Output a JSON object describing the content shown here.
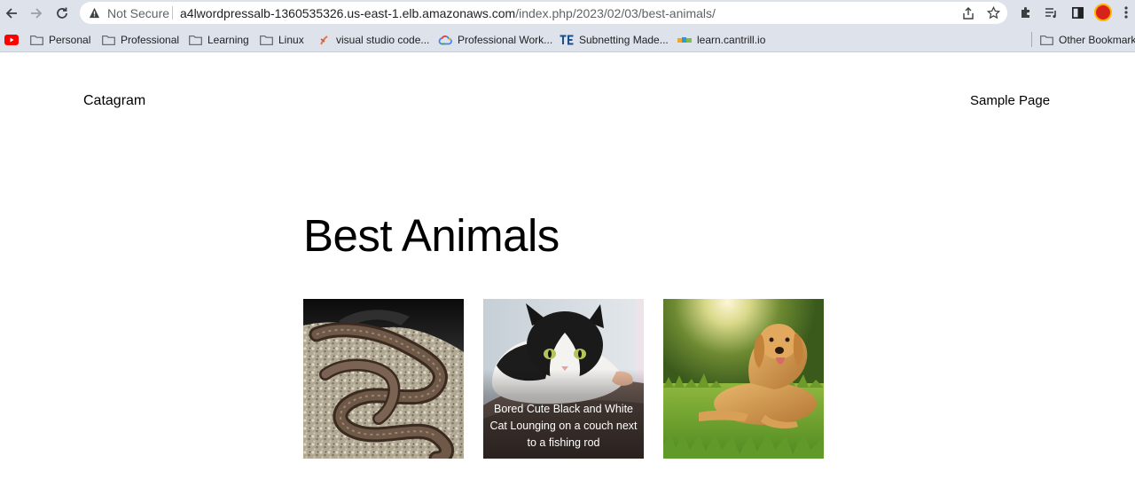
{
  "browser": {
    "security_label": "Not Secure",
    "url_host": "a4lwordpressalb-1360535326.us-east-1.elb.amazonaws.com",
    "url_path": "/index.php/2023/02/03/best-animals/"
  },
  "bookmarks": {
    "items": [
      {
        "label": "Personal",
        "icon": "folder-icon"
      },
      {
        "label": "Professional",
        "icon": "folder-icon"
      },
      {
        "label": "Learning",
        "icon": "folder-icon"
      },
      {
        "label": "Linux",
        "icon": "folder-icon"
      },
      {
        "label": "visual studio code...",
        "icon": "vscode-icon"
      },
      {
        "label": "Professional Work...",
        "icon": "google-cloud-icon"
      },
      {
        "label": "Subnetting Made...",
        "icon": "te-icon"
      },
      {
        "label": "learn.cantrill.io",
        "icon": "cantrill-icon"
      }
    ],
    "other": "Other Bookmarks"
  },
  "site": {
    "title": "Catagram",
    "nav": [
      "Sample Page"
    ]
  },
  "post": {
    "title": "Best Animals",
    "gallery": [
      {
        "image": "snake",
        "caption": ""
      },
      {
        "image": "cat",
        "caption": "Bored Cute Black and White Cat Lounging on a couch next to a fishing rod"
      },
      {
        "image": "dog",
        "caption": ""
      }
    ]
  },
  "colors": {
    "toolbar": "#dee3eb",
    "youtube": "#ff0000",
    "profile": "#d7231c"
  }
}
